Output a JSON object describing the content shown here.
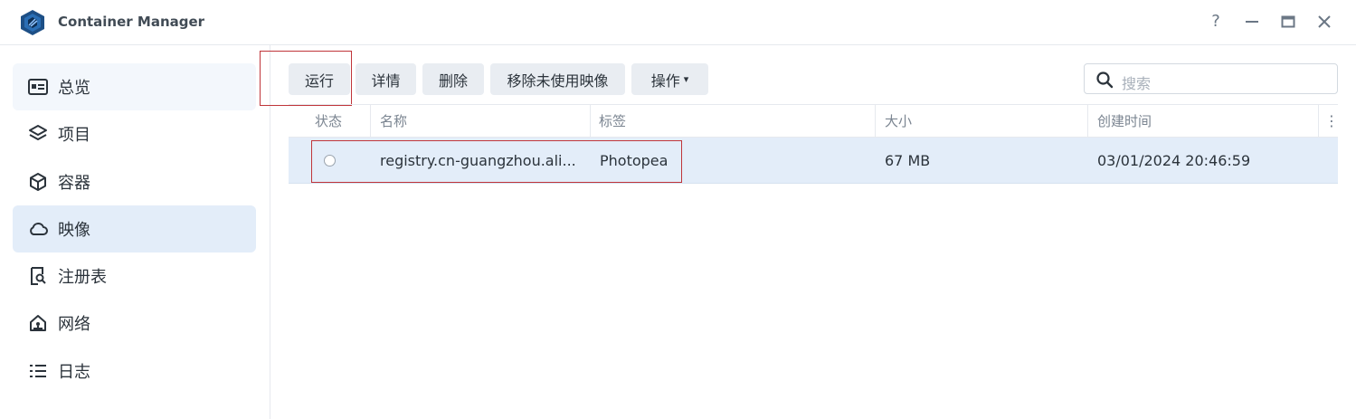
{
  "window": {
    "title": "Container Manager",
    "help": "?",
    "minimize": "—",
    "maximize": "▭",
    "close": "✕"
  },
  "sidebar": {
    "items": [
      {
        "label": "总览",
        "icon": "overview-icon"
      },
      {
        "label": "项目",
        "icon": "layers-icon"
      },
      {
        "label": "容器",
        "icon": "cube-icon"
      },
      {
        "label": "映像",
        "icon": "cloud-icon"
      },
      {
        "label": "注册表",
        "icon": "registry-search-icon"
      },
      {
        "label": "网络",
        "icon": "network-home-icon"
      },
      {
        "label": "日志",
        "icon": "list-icon"
      }
    ],
    "active": "映像"
  },
  "toolbar": {
    "run": "运行",
    "details": "详情",
    "delete": "删除",
    "remove_unused": "移除未使用映像",
    "actions": "操作",
    "actions_caret": "▾"
  },
  "search": {
    "placeholder": "搜索"
  },
  "table": {
    "headers": {
      "status": "状态",
      "name": "名称",
      "tag": "标签",
      "size": "大小",
      "created": "创建时间",
      "menu": "⋮"
    },
    "rows": [
      {
        "name": "registry.cn-guangzhou.ali...",
        "tag": "Photopea",
        "size": "67 MB",
        "created": "03/01/2024 20:46:59"
      }
    ]
  },
  "colors": {
    "accent": "#e3edf9",
    "highlight_box": "#c0353a",
    "button_bg": "#e9edf2"
  }
}
